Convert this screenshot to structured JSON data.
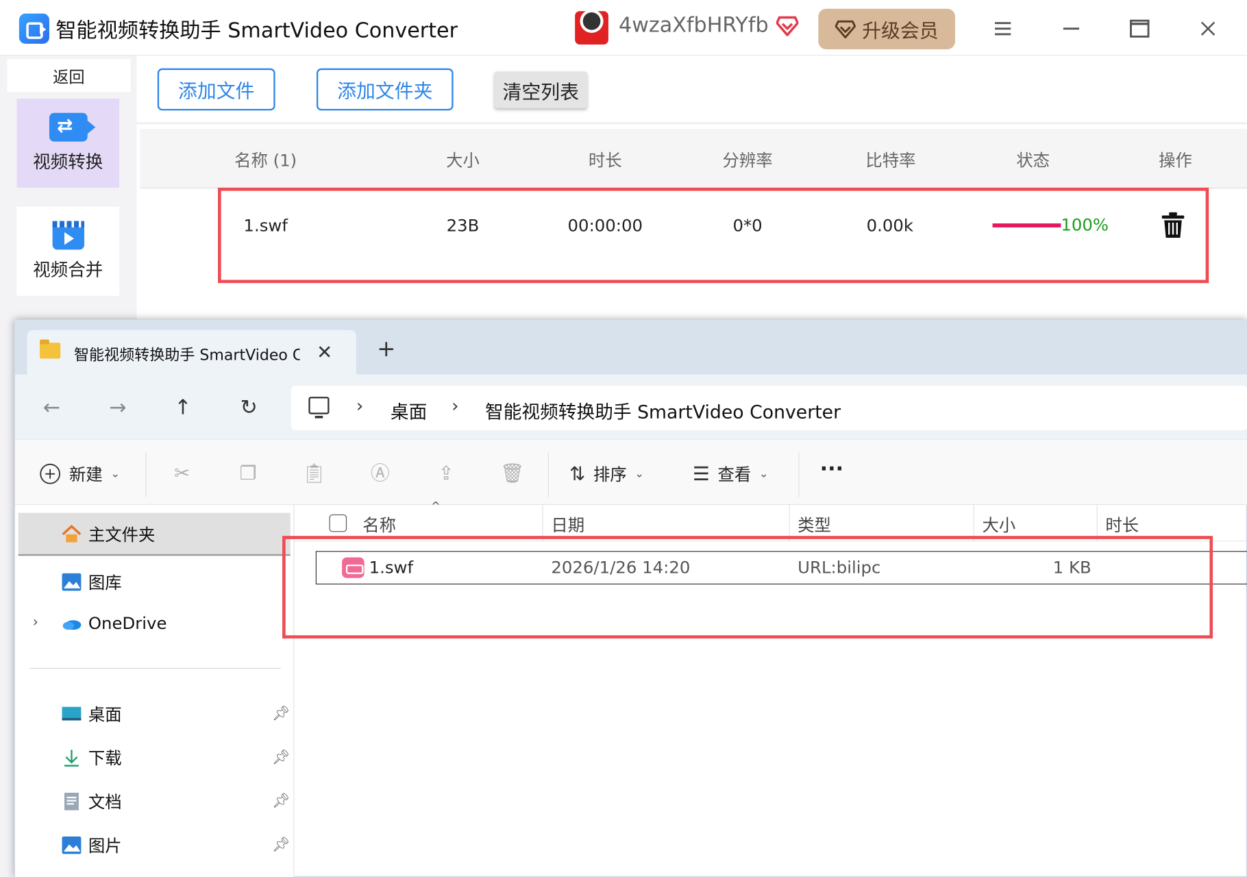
{
  "app": {
    "title": "智能视频转换助手 SmartVideo Converter",
    "username": "4wzaXfbHRYfb",
    "upgrade_label": "升级会员",
    "accent": "#2c86e8",
    "highlight": "#ef4c54"
  },
  "sidebar": {
    "back_label": "返回",
    "items": [
      {
        "label": "视频转换",
        "icon": "video-convert-icon",
        "active": true
      },
      {
        "label": "视频合并",
        "icon": "video-merge-icon",
        "active": false
      }
    ]
  },
  "toolbar": {
    "add_file": "添加文件",
    "add_folder": "添加文件夹",
    "clear_list": "清空列表"
  },
  "table": {
    "headers": [
      "名称 (1)",
      "大小",
      "时长",
      "分辨率",
      "比特率",
      "状态",
      "操作"
    ],
    "rows": [
      {
        "name": "1.swf",
        "size": "23B",
        "duration": "00:00:00",
        "resolution": "0*0",
        "bitrate": "0.00k",
        "progress": 1.0,
        "progress_label": "100%"
      }
    ]
  },
  "explorer": {
    "tab_title": "智能视频转换助手 SmartVideo Converter",
    "breadcrumb": [
      "桌面",
      "智能视频转换助手 SmartVideo Converter"
    ],
    "commands": {
      "new": "新建",
      "sort": "排序",
      "view": "查看"
    },
    "nav": {
      "home": "主文件夹",
      "gallery": "图库",
      "onedrive": "OneDrive",
      "pinned": [
        "桌面",
        "下载",
        "文档",
        "图片"
      ]
    },
    "columns": [
      "名称",
      "日期",
      "类型",
      "大小",
      "时长"
    ],
    "files": [
      {
        "name": "1.swf",
        "date": "2026/1/26 14:20",
        "type": "URL:bilipc",
        "size": "1 KB"
      }
    ]
  }
}
